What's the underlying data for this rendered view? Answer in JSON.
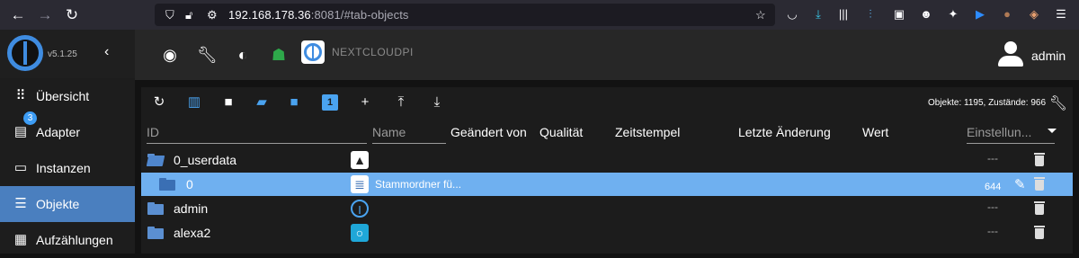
{
  "browser": {
    "url_host": "192.168.178.36",
    "url_rest": ":8081/#tab-objects",
    "back_icon": "arrow-left-icon",
    "forward_icon": "arrow-right-icon",
    "reload_icon": "reload-icon"
  },
  "sidebar": {
    "version": "v5.1.25",
    "items": [
      {
        "label": "Übersicht",
        "icon": "grid-icon"
      },
      {
        "label": "Adapter",
        "icon": "store-icon",
        "badge": "3"
      },
      {
        "label": "Instanzen",
        "icon": "instances-icon"
      },
      {
        "label": "Objekte",
        "icon": "list-icon",
        "active": true
      },
      {
        "label": "Aufzählungen",
        "icon": "enum-icon"
      }
    ]
  },
  "header": {
    "brand": "NEXTCLOUDPI",
    "user": "admin"
  },
  "objects": {
    "counts": "Objekte: 1195, Zustände: 966",
    "columns": {
      "id": "ID",
      "name": "Name",
      "changed_by": "Geändert von",
      "quality": "Qualität",
      "timestamp": "Zeitstempel",
      "last_change": "Letzte Änderung",
      "value": "Wert",
      "settings": "Einstellun..."
    },
    "rows": [
      {
        "id": "0_userdata",
        "name": "",
        "settings": "---"
      },
      {
        "id": "0",
        "name": "Stammordner fü...",
        "settings": "644"
      },
      {
        "id": "admin",
        "name": "",
        "settings": "---"
      },
      {
        "id": "alexa2",
        "name": "",
        "settings": "---"
      }
    ]
  },
  "colors": {
    "accent": "#4a7fbf",
    "selected_row": "#6fb0f0",
    "icon_blue": "#4aa3f0",
    "alexa_teal": "#1fa7d8"
  }
}
